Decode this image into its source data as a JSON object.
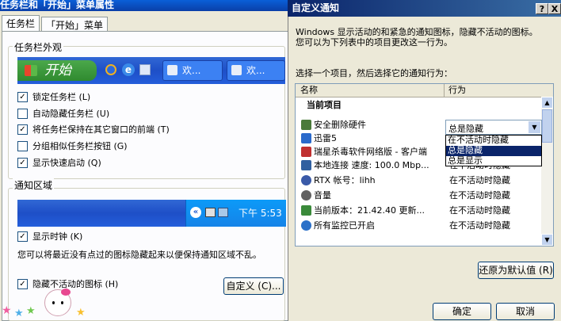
{
  "taskbar_props": {
    "title": "任务栏和「开始」菜单属性",
    "tabs": [
      "任务栏",
      "「开始」菜单"
    ],
    "appearance_group": "任务栏外观",
    "start_label": "开始",
    "task_buttons": [
      "欢...",
      "欢..."
    ],
    "options": [
      {
        "label": "锁定任务栏 (L)",
        "checked": true
      },
      {
        "label": "自动隐藏任务栏 (U)",
        "checked": false
      },
      {
        "label": "将任务栏保持在其它窗口的前端 (T)",
        "checked": true
      },
      {
        "label": "分组相似任务栏按钮 (G)",
        "checked": false
      },
      {
        "label": "显示快速启动 (Q)",
        "checked": true
      }
    ],
    "notify_group": "通知区域",
    "clock": "下午 5:53",
    "show_clock": {
      "label": "显示时钟 (K)",
      "checked": true
    },
    "notify_desc": "您可以将最近没有点过的图标隐藏起来以便保持通知区域不乱。",
    "hide_inactive": {
      "label": "隐藏不活动的图标 (H)",
      "checked": true
    },
    "customize_label": "自定义 (C)..."
  },
  "dialog": {
    "title": "自定义通知",
    "help_btn": "?",
    "close_btn": "X",
    "desc_line1": "Windows 显示活动的和紧急的通知图标，隐藏不活动的图标。",
    "desc_line2": "您可以为下列表中的项目更改这一行为。",
    "instruction": "选择一个项目，然后选择它的通知行为：",
    "col_name": "名称",
    "col_behavior": "行为",
    "section": "当前项目",
    "items": [
      {
        "name": "安全删除硬件",
        "behavior": "总是隐藏",
        "color": "#4a7a3a"
      },
      {
        "name": "迅雷5",
        "behavior": "",
        "color": "#2a6acb"
      },
      {
        "name": "瑞星杀毒软件网络版 - 客户端",
        "behavior": "",
        "color": "#c03030"
      },
      {
        "name": "本地连接 速度: 100.0 Mbp...",
        "behavior": "在不活动时隐藏",
        "color": "#3060a0"
      },
      {
        "name": "RTX 帐号：lihh",
        "behavior": "在不活动时隐藏",
        "color": "#3a5aa8"
      },
      {
        "name": "音量",
        "behavior": "在不活动时隐藏",
        "color": "#606060"
      },
      {
        "name": "当前版本：21.42.40 更新...",
        "behavior": "在不活动时隐藏",
        "color": "#3a8a3a"
      },
      {
        "name": "所有监控已开启",
        "behavior": "在不活动时隐藏",
        "color": "#2a70c8"
      }
    ],
    "dropdown_options": [
      "在不活动时隐藏",
      "总是隐藏",
      "总是显示"
    ],
    "dropdown_selected": "总是隐藏",
    "restore_label": "还原为默认值 (R)",
    "ok_label": "确定",
    "cancel_label": "取消"
  }
}
